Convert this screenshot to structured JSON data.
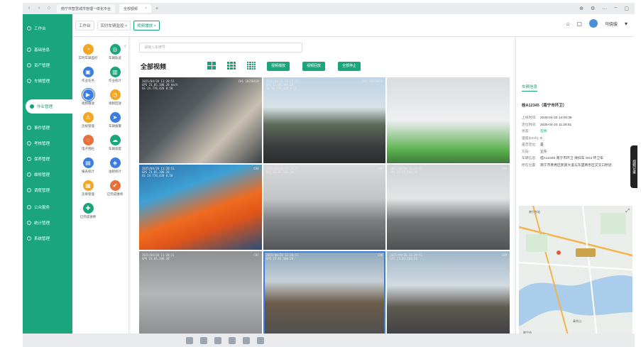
{
  "browser": {
    "tabs": [
      {
        "label": "南宁市智慧城市管理一体化平台"
      },
      {
        "label": "全部视频"
      }
    ],
    "new_tab": "+",
    "controls": [
      "⊕",
      "⚙",
      "…",
      "−",
      "▢"
    ]
  },
  "header": {
    "tabs": [
      {
        "label": "工作台"
      },
      {
        "label": "实时车辆监控 ×"
      },
      {
        "label": "视频播放 ×"
      }
    ],
    "user_name": "马骁骏",
    "caret": "▾"
  },
  "sidebar": {
    "items": [
      {
        "label": "工作台"
      },
      {
        "label": "基础信息"
      },
      {
        "label": "资产管理"
      },
      {
        "label": "车辆管理"
      },
      {
        "label": "作业管理"
      },
      {
        "label": "事件管理"
      },
      {
        "label": "考核管理"
      },
      {
        "label": "保养管理"
      },
      {
        "label": "维修管理"
      },
      {
        "label": "调度管理"
      },
      {
        "label": "公众服务"
      },
      {
        "label": "统计管理"
      },
      {
        "label": "系统管理"
      }
    ],
    "active_index": 4
  },
  "submenu": {
    "collapse": "‹",
    "items": [
      {
        "label": "实时车辆监控",
        "color": "#f2a623"
      },
      {
        "label": "车辆轨迹",
        "color": "#1aa57d"
      },
      {
        "label": "作业任务",
        "color": "#3b7de0"
      },
      {
        "label": "作业统计",
        "color": "#1aa57d"
      },
      {
        "label": "视频播放",
        "color": "#3b7de0"
      },
      {
        "label": "视频回放",
        "color": "#f2a623"
      },
      {
        "label": "违规管理",
        "color": "#f2a623"
      },
      {
        "label": "车辆报警",
        "color": "#3b7de0"
      },
      {
        "label": "电子围栏",
        "color": "#e8713a"
      },
      {
        "label": "车辆调度",
        "color": "#1aa57d"
      },
      {
        "label": "报表统计",
        "color": "#3b7de0"
      },
      {
        "label": "油耗统计",
        "color": "#3b7de0"
      },
      {
        "label": "违章管理",
        "color": "#f2a623"
      },
      {
        "label": "已完成维修",
        "color": "#e8713a"
      },
      {
        "label": "已完成保养",
        "color": "#1aa57d"
      }
    ],
    "selected_index": 4
  },
  "main": {
    "search_placeholder": "请输入车牌号",
    "title": "全部视频",
    "buttons": [
      "视频播放",
      "视频回放",
      "全部停止"
    ],
    "videos": [
      {
        "osd": "2025/04/20 11:28:51\nGPS 23.05,108.28 km/h\nGS 24.778,428 0.58",
        "cam": "CH1 20250420"
      },
      {
        "osd": "2025/04/20 11:28:51\nGPS 23.05,108.28\nGS 24.778,428 0.58",
        "cam": "CH2 20250420"
      },
      {
        "osd": "",
        "cam": ""
      },
      {
        "osd": "2025/04/20 11:28:51\nGPS 23.05,108.28\nGS 24.778,428 0.58",
        "cam": "CH4"
      },
      {
        "osd": "2025/04/20 11:28:51\nGPS 23.05,108.28",
        "cam": "CH5"
      },
      {
        "osd": "2025/04/20 11:28:51\nGPS 23.05,108.28",
        "cam": "CH6"
      },
      {
        "osd": "2025/04/20 11:28:51\nGPS 23.05,108.28",
        "cam": "CH7"
      },
      {
        "osd": "2025/04/20 11:28:51\nGPS 23.05,108.28",
        "cam": "CH8"
      },
      {
        "osd": "2025/04/20 11:28:51\nGPS 23.05,108.28",
        "cam": "CH9"
      }
    ],
    "selected_video": 7
  },
  "panel": {
    "tab": "车辆信息",
    "title": "桂A12345（南宁市环卫）",
    "info": [
      {
        "k": "上线时间:",
        "v": "2025-04-20 14:09:38"
      },
      {
        "k": "定位时间:",
        "v": "2025-04-20 11:28:51"
      },
      {
        "k": "状态:",
        "v": "在线",
        "link": true
      },
      {
        "k": "速度(km/h):",
        "v": "0"
      },
      {
        "k": "是否定位:",
        "v": "是"
      },
      {
        "k": "方向:",
        "v": "正东"
      },
      {
        "k": "车辆信息:",
        "v": "桂A12345 南宁市环卫 清扫车 SG3 环卫车"
      },
      {
        "k": "所在位置:",
        "v": "南宁市青秀区民族大道与东盟商务区交叉口附近"
      }
    ],
    "map_labels": [
      "南宁东站",
      "青秀山",
      "南宁市"
    ]
  },
  "side_tab": "视频记录"
}
